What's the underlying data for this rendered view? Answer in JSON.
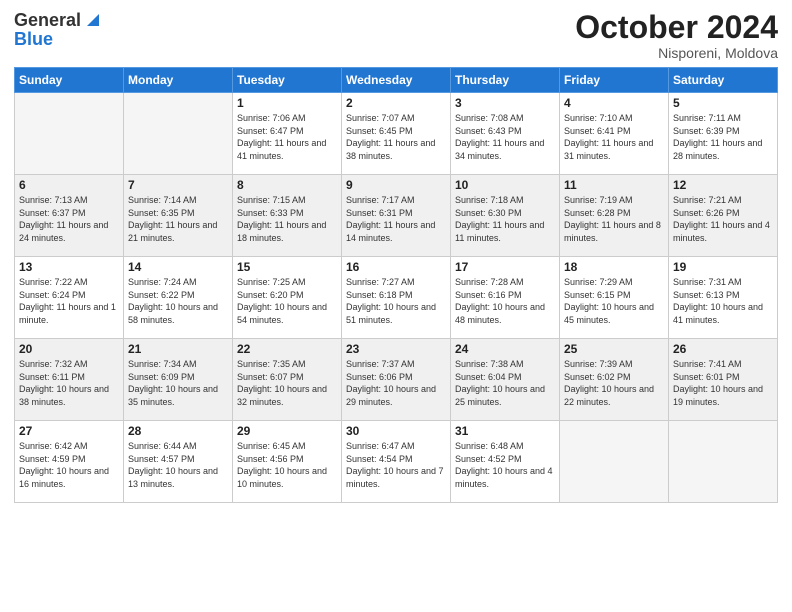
{
  "header": {
    "logo_general": "General",
    "logo_blue": "Blue",
    "month_title": "October 2024",
    "location": "Nisporeni, Moldova"
  },
  "days_of_week": [
    "Sunday",
    "Monday",
    "Tuesday",
    "Wednesday",
    "Thursday",
    "Friday",
    "Saturday"
  ],
  "weeks": [
    [
      {
        "day": "",
        "info": ""
      },
      {
        "day": "",
        "info": ""
      },
      {
        "day": "1",
        "info": "Sunrise: 7:06 AM\nSunset: 6:47 PM\nDaylight: 11 hours and 41 minutes."
      },
      {
        "day": "2",
        "info": "Sunrise: 7:07 AM\nSunset: 6:45 PM\nDaylight: 11 hours and 38 minutes."
      },
      {
        "day": "3",
        "info": "Sunrise: 7:08 AM\nSunset: 6:43 PM\nDaylight: 11 hours and 34 minutes."
      },
      {
        "day": "4",
        "info": "Sunrise: 7:10 AM\nSunset: 6:41 PM\nDaylight: 11 hours and 31 minutes."
      },
      {
        "day": "5",
        "info": "Sunrise: 7:11 AM\nSunset: 6:39 PM\nDaylight: 11 hours and 28 minutes."
      }
    ],
    [
      {
        "day": "6",
        "info": "Sunrise: 7:13 AM\nSunset: 6:37 PM\nDaylight: 11 hours and 24 minutes."
      },
      {
        "day": "7",
        "info": "Sunrise: 7:14 AM\nSunset: 6:35 PM\nDaylight: 11 hours and 21 minutes."
      },
      {
        "day": "8",
        "info": "Sunrise: 7:15 AM\nSunset: 6:33 PM\nDaylight: 11 hours and 18 minutes."
      },
      {
        "day": "9",
        "info": "Sunrise: 7:17 AM\nSunset: 6:31 PM\nDaylight: 11 hours and 14 minutes."
      },
      {
        "day": "10",
        "info": "Sunrise: 7:18 AM\nSunset: 6:30 PM\nDaylight: 11 hours and 11 minutes."
      },
      {
        "day": "11",
        "info": "Sunrise: 7:19 AM\nSunset: 6:28 PM\nDaylight: 11 hours and 8 minutes."
      },
      {
        "day": "12",
        "info": "Sunrise: 7:21 AM\nSunset: 6:26 PM\nDaylight: 11 hours and 4 minutes."
      }
    ],
    [
      {
        "day": "13",
        "info": "Sunrise: 7:22 AM\nSunset: 6:24 PM\nDaylight: 11 hours and 1 minute."
      },
      {
        "day": "14",
        "info": "Sunrise: 7:24 AM\nSunset: 6:22 PM\nDaylight: 10 hours and 58 minutes."
      },
      {
        "day": "15",
        "info": "Sunrise: 7:25 AM\nSunset: 6:20 PM\nDaylight: 10 hours and 54 minutes."
      },
      {
        "day": "16",
        "info": "Sunrise: 7:27 AM\nSunset: 6:18 PM\nDaylight: 10 hours and 51 minutes."
      },
      {
        "day": "17",
        "info": "Sunrise: 7:28 AM\nSunset: 6:16 PM\nDaylight: 10 hours and 48 minutes."
      },
      {
        "day": "18",
        "info": "Sunrise: 7:29 AM\nSunset: 6:15 PM\nDaylight: 10 hours and 45 minutes."
      },
      {
        "day": "19",
        "info": "Sunrise: 7:31 AM\nSunset: 6:13 PM\nDaylight: 10 hours and 41 minutes."
      }
    ],
    [
      {
        "day": "20",
        "info": "Sunrise: 7:32 AM\nSunset: 6:11 PM\nDaylight: 10 hours and 38 minutes."
      },
      {
        "day": "21",
        "info": "Sunrise: 7:34 AM\nSunset: 6:09 PM\nDaylight: 10 hours and 35 minutes."
      },
      {
        "day": "22",
        "info": "Sunrise: 7:35 AM\nSunset: 6:07 PM\nDaylight: 10 hours and 32 minutes."
      },
      {
        "day": "23",
        "info": "Sunrise: 7:37 AM\nSunset: 6:06 PM\nDaylight: 10 hours and 29 minutes."
      },
      {
        "day": "24",
        "info": "Sunrise: 7:38 AM\nSunset: 6:04 PM\nDaylight: 10 hours and 25 minutes."
      },
      {
        "day": "25",
        "info": "Sunrise: 7:39 AM\nSunset: 6:02 PM\nDaylight: 10 hours and 22 minutes."
      },
      {
        "day": "26",
        "info": "Sunrise: 7:41 AM\nSunset: 6:01 PM\nDaylight: 10 hours and 19 minutes."
      }
    ],
    [
      {
        "day": "27",
        "info": "Sunrise: 6:42 AM\nSunset: 4:59 PM\nDaylight: 10 hours and 16 minutes."
      },
      {
        "day": "28",
        "info": "Sunrise: 6:44 AM\nSunset: 4:57 PM\nDaylight: 10 hours and 13 minutes."
      },
      {
        "day": "29",
        "info": "Sunrise: 6:45 AM\nSunset: 4:56 PM\nDaylight: 10 hours and 10 minutes."
      },
      {
        "day": "30",
        "info": "Sunrise: 6:47 AM\nSunset: 4:54 PM\nDaylight: 10 hours and 7 minutes."
      },
      {
        "day": "31",
        "info": "Sunrise: 6:48 AM\nSunset: 4:52 PM\nDaylight: 10 hours and 4 minutes."
      },
      {
        "day": "",
        "info": ""
      },
      {
        "day": "",
        "info": ""
      }
    ]
  ]
}
